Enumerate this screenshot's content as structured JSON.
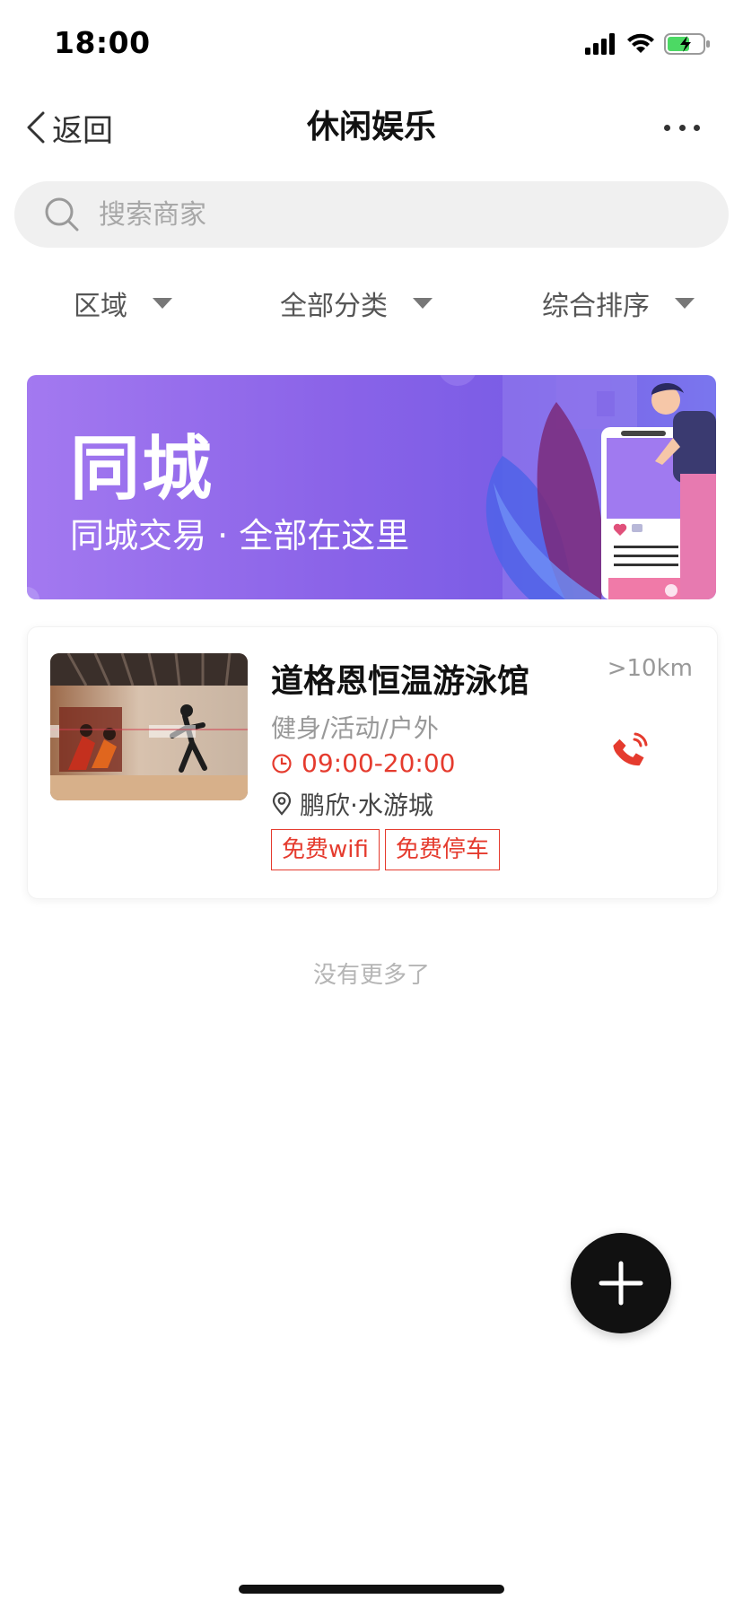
{
  "status_bar": {
    "time": "18:00"
  },
  "nav": {
    "back_label": "返回",
    "title": "休闲娱乐"
  },
  "search": {
    "placeholder": "搜索商家",
    "value": ""
  },
  "filters": [
    {
      "label": "区域"
    },
    {
      "label": "全部分类"
    },
    {
      "label": "综合排序"
    }
  ],
  "banner": {
    "title": "同城",
    "subtitle": "同城交易 · 全部在这里"
  },
  "merchants": [
    {
      "name": "道格恩恒温游泳馆",
      "distance": ">10km",
      "category": "健身/活动/户外",
      "hours": "09:00-20:00",
      "address": "鹏欣·水游城",
      "tags": [
        "免费wifi",
        "免费停车"
      ]
    }
  ],
  "footer": {
    "no_more": "没有更多了"
  },
  "colors": {
    "accent": "#e53b2e",
    "banner_start": "#a379f0",
    "banner_end": "#7a76ee",
    "fab": "#111111"
  },
  "icons": [
    "signal-icon",
    "wifi-icon",
    "battery-icon",
    "back-chevron-icon",
    "more-icon",
    "search-icon",
    "caret-down-icon",
    "clock-icon",
    "location-pin-icon",
    "phone-icon",
    "plus-icon"
  ]
}
